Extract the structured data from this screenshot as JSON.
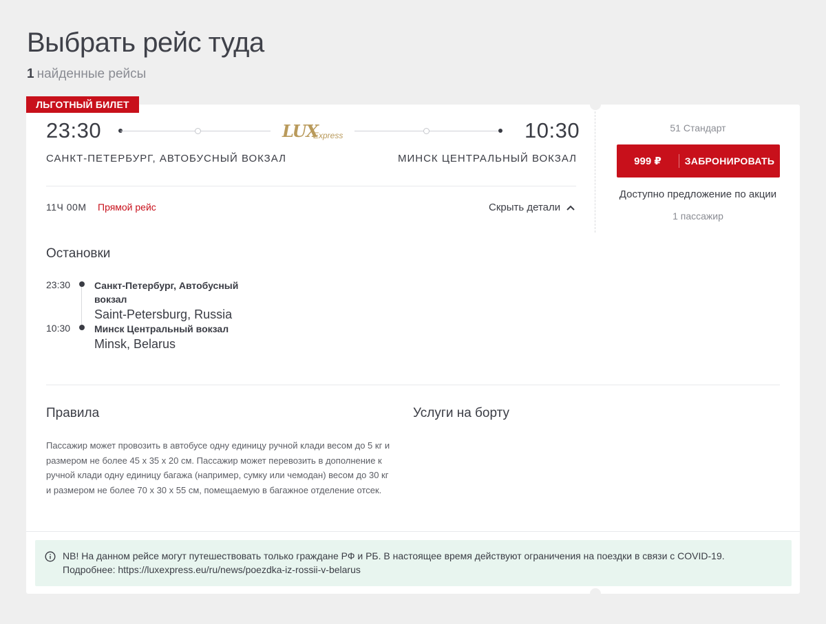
{
  "page": {
    "title": "Выбрать рейс туда",
    "results_count": "1",
    "results_label": "найденные рейсы"
  },
  "trip": {
    "badge": "ЛЬГОТНЫЙ БИЛЕТ",
    "departure_time": "23:30",
    "arrival_time": "10:30",
    "departure_station": "САНКТ-ПЕТЕРБУРГ, АВТОБУСНЫЙ ВОКЗАЛ",
    "arrival_station": "МИНСК ЦЕНТРАЛЬНЫЙ ВОКЗАЛ",
    "carrier_logo": {
      "main": "LUX",
      "sub": "Express",
      "color": "#b99a5b"
    },
    "duration": "11Ч 00М",
    "route_type": "Прямой рейс",
    "hide_details": "Скрыть детали"
  },
  "booking": {
    "fare_class": "51 Стандарт",
    "price": "999 ₽",
    "book_label": "ЗАБРОНИРОВАТЬ",
    "promo_note": "Доступно предложение по акции",
    "passengers": "1 пассажир"
  },
  "stops": {
    "title": "Остановки",
    "items": [
      {
        "time": "23:30",
        "name": "Санкт-Петербург, Автобусный вокзал",
        "city": "Saint-Petersburg, Russia"
      },
      {
        "time": "10:30",
        "name": "Минск Центральный вокзал",
        "city": "Minsk, Belarus"
      }
    ]
  },
  "rules": {
    "title": "Правила",
    "text": "Пассажир может провозить в автобусе одну единицу ручной клади весом до 5 кг и размером не более 45 х 35 х 20 см. Пассажир может перевозить в дополнение к ручной клади одну единицу багажа (например, сумку или чемодан) весом до 30 кг и размером не более 70 х 30 х 55 см, помещаемую в багажное отделение отсек."
  },
  "services": {
    "title": "Услуги на борту"
  },
  "notice": {
    "text": "NB! На данном рейсе могут путешествовать только граждане РФ и РБ. В настоящее время действуют ограничения на поездки в связи с COVID-19. Подробнее: https://luxexpress.eu/ru/news/poezdka-iz-rossii-v-belarus"
  },
  "colors": {
    "accent": "#c8101b",
    "notice_bg": "#e8f5ef",
    "page_bg": "#efefef"
  }
}
